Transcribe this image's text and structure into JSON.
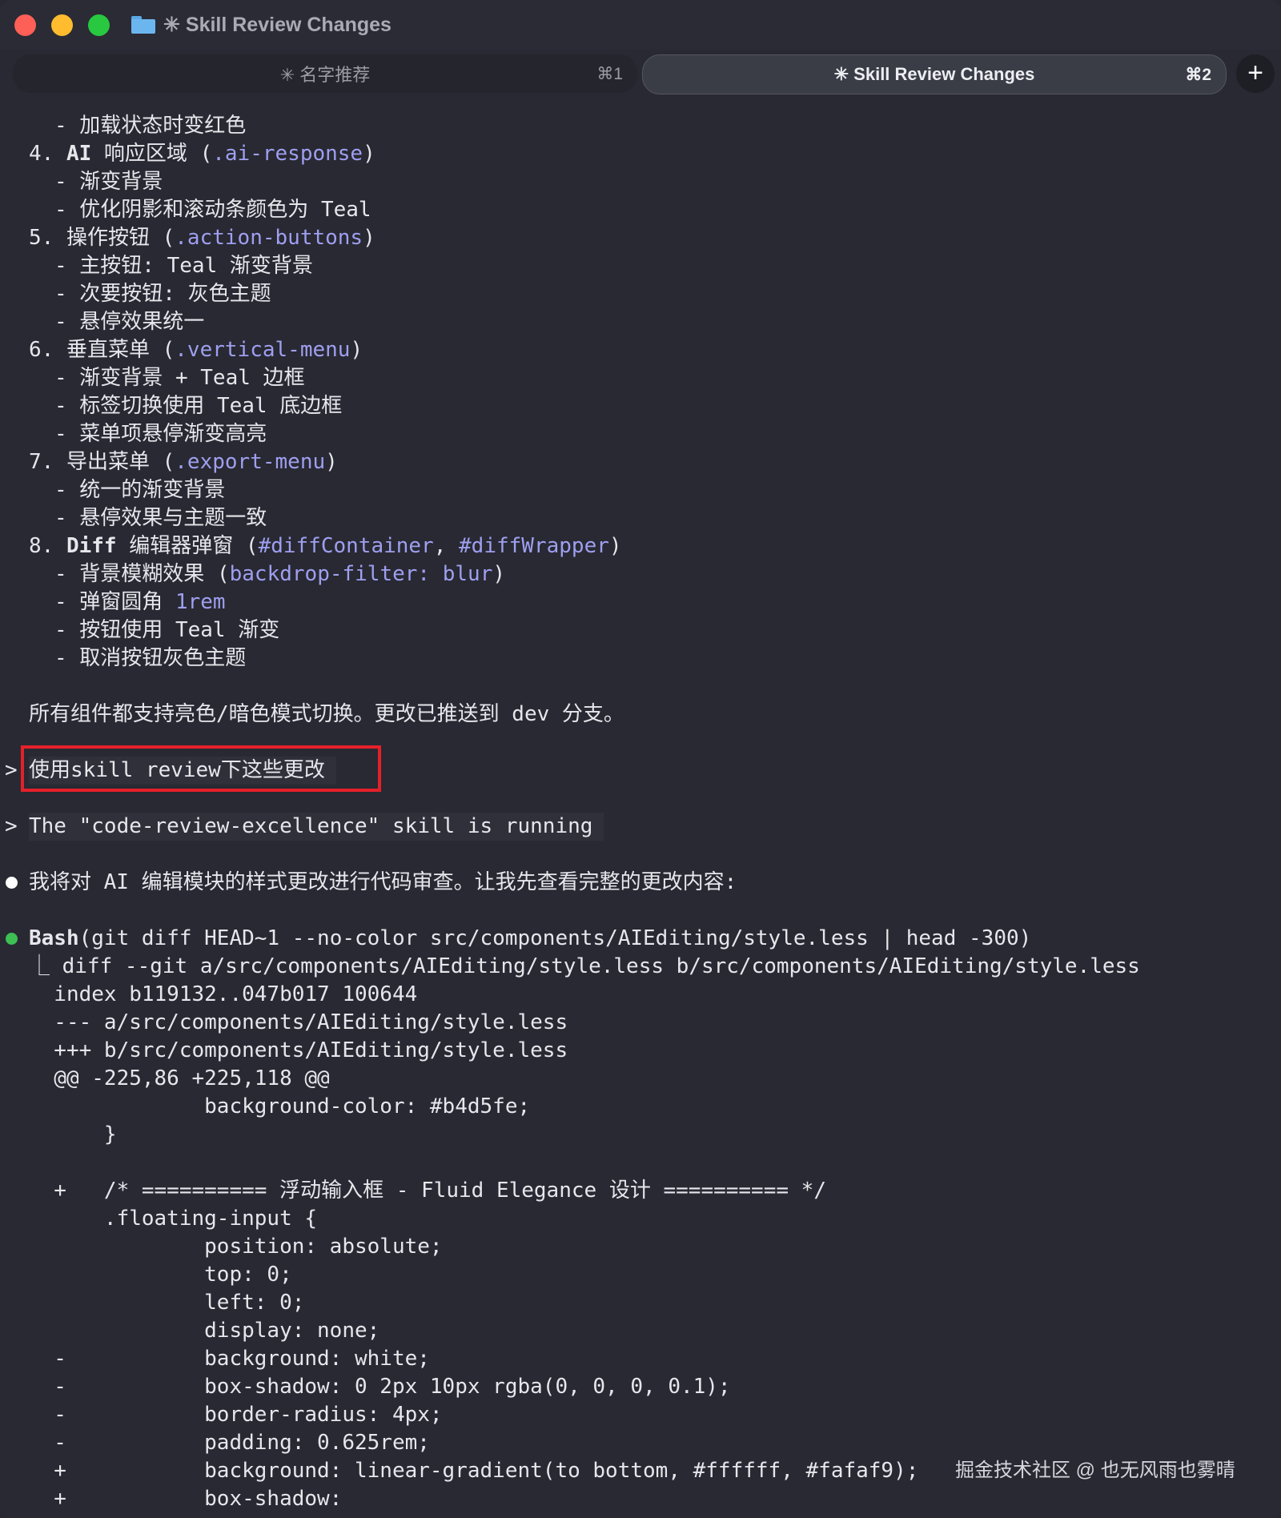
{
  "window": {
    "title": "✳ Skill Review Changes"
  },
  "tabs": [
    {
      "label": "✳ 名字推荐",
      "shortcut": "⌘1"
    },
    {
      "label": "✳ Skill Review Changes",
      "shortcut": "⌘2"
    }
  ],
  "new_tab_label": "+",
  "terminal": {
    "list_lines": [
      {
        "text": "- 加载状态时变红色"
      },
      {
        "prefix": "4. ",
        "bold": "AI",
        "text": " 响应区域 (",
        "code": ".ai-response",
        "suffix": ")"
      },
      {
        "text": "- 渐变背景"
      },
      {
        "text": "- 优化阴影和滚动条颜色为 Teal"
      },
      {
        "prefix": "5. ",
        "text": "操作按钮 (",
        "code": ".action-buttons",
        "suffix": ")"
      },
      {
        "text": "- 主按钮: Teal 渐变背景"
      },
      {
        "text": "- 次要按钮: 灰色主题"
      },
      {
        "text": "- 悬停效果统一"
      },
      {
        "prefix": "6. ",
        "text": "垂直菜单 (",
        "code": ".vertical-menu",
        "suffix": ")"
      },
      {
        "text": "- 渐变背景 + Teal 边框"
      },
      {
        "text": "- 标签切换使用 Teal 底边框"
      },
      {
        "text": "- 菜单项悬停渐变高亮"
      },
      {
        "prefix": "7. ",
        "text": "导出菜单 (",
        "code": ".export-menu",
        "suffix": ")"
      },
      {
        "text": "- 统一的渐变背景"
      },
      {
        "text": "- 悬停效果与主题一致"
      },
      {
        "prefix": "8. ",
        "bold": "Diff",
        "text": " 编辑器弹窗 (",
        "code": "#diffContainer",
        "mid": ", ",
        "code2": "#diffWrapper",
        "suffix": ")"
      },
      {
        "text": "- 背景模糊效果 (",
        "code": "backdrop-filter: blur",
        "suffix": ")"
      },
      {
        "text": "- 弹窗圆角 ",
        "code": "1rem"
      },
      {
        "text": "- 按钮使用 Teal 渐变"
      },
      {
        "text": "- 取消按钮灰色主题"
      }
    ],
    "summary": "所有组件都支持亮色/暗色模式切换。更改已推送到 dev 分支。",
    "prompt_symbol": ">",
    "user_prompt": "使用skill review下这些更改",
    "skill_status": "The \"code-review-excellence\" skill is running",
    "assistant_message": "我将对 AI 编辑模块的样式更改进行代码审查。让我先查看完整的更改内容:",
    "bash_tool": "Bash",
    "bash_command": "(git diff HEAD~1 --no-color src/components/AIEditing/style.less | head -300)",
    "diff_lines": [
      "⎿ diff --git a/src/components/AIEditing/style.less b/src/components/AIEditing/style.less",
      "  index b119132..047b017 100644",
      "  --- a/src/components/AIEditing/style.less",
      "  +++ b/src/components/AIEditing/style.less",
      "  @@ -225,86 +225,118 @@",
      "              background-color: #b4d5fe;",
      "      }",
      "",
      "  +   /* ========== 浮动输入框 - Fluid Elegance 设计 ========== */",
      "      .floating-input {",
      "              position: absolute;",
      "              top: 0;",
      "              left: 0;",
      "              display: none;",
      "  -           background: white;",
      "  -           box-shadow: 0 2px 10px rgba(0, 0, 0, 0.1);",
      "  -           border-radius: 4px;",
      "  -           padding: 0.625rem;",
      "  +           background: linear-gradient(to bottom, #ffffff, #fafaf9);",
      "  +           box-shadow:"
    ]
  },
  "watermark": "掘金技术社区 @ 也无风雨也雾晴"
}
